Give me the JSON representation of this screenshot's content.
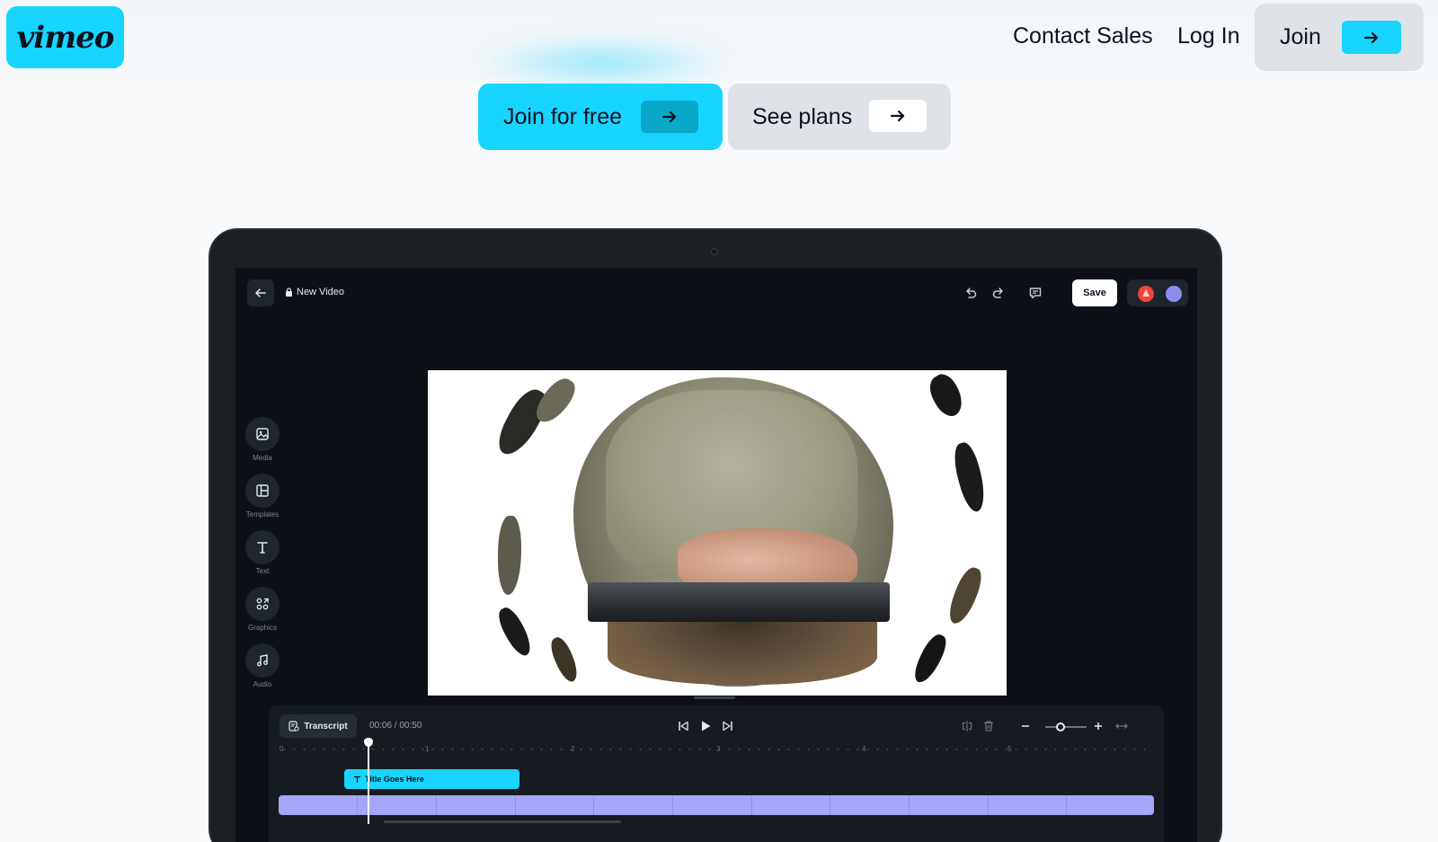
{
  "nav": {
    "logo_text": "vimeo",
    "contact_label": "Contact Sales",
    "login_label": "Log In",
    "join_label": "Join"
  },
  "hero": {
    "cta_primary_label": "Join for free",
    "cta_secondary_label": "See plans"
  },
  "editor": {
    "file_title": "New Video",
    "save_label": "Save",
    "tools": [
      {
        "label": "Media",
        "icon": "image-icon"
      },
      {
        "label": "Templates",
        "icon": "layout-icon"
      },
      {
        "label": "Text",
        "icon": "text-icon"
      },
      {
        "label": "Graphics",
        "icon": "shapes-icon"
      },
      {
        "label": "Audio",
        "icon": "music-icon"
      }
    ],
    "timeline": {
      "transcript_label": "Transcript",
      "timecode": "00:06 / 00:50",
      "ruler_ticks": [
        "0",
        "1",
        "2",
        "3",
        "4",
        "5"
      ],
      "title_clip_label": "Title Goes Here"
    }
  },
  "colors": {
    "brand_accent": "#17d5ff",
    "page_bg": "#f8fafc",
    "editor_bg": "#0d1117",
    "video_track": "#a5a6f6"
  }
}
